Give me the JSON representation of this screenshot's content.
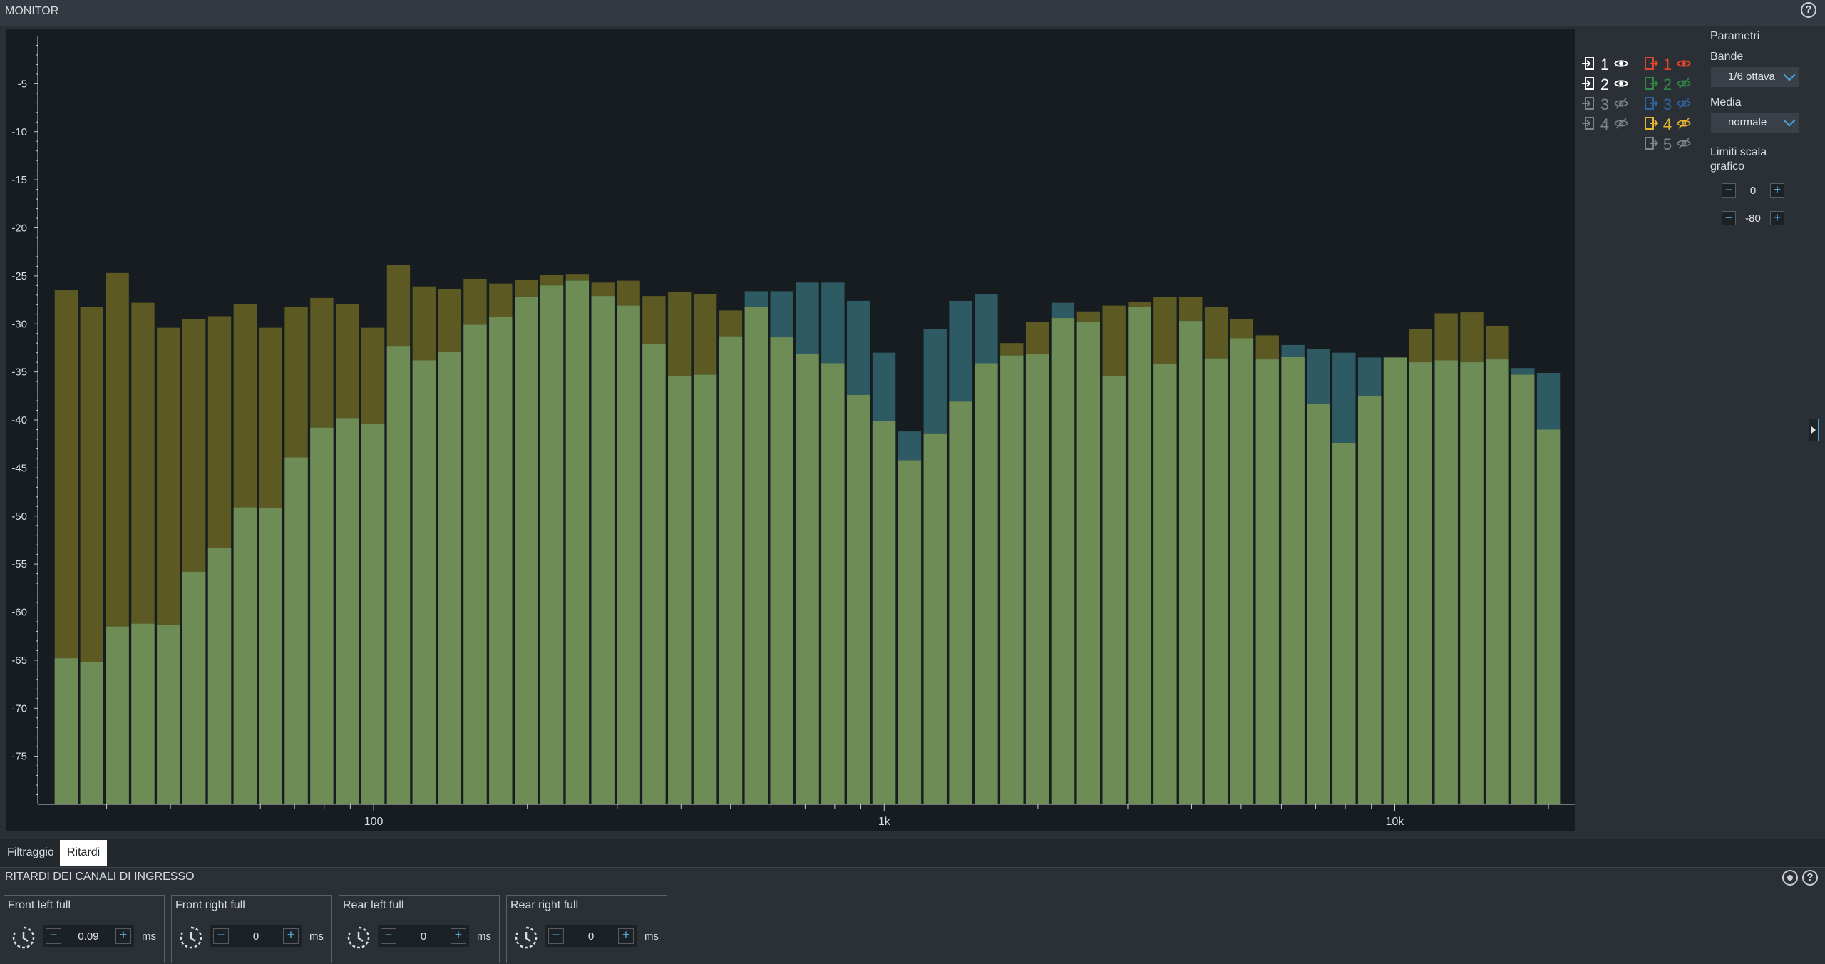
{
  "app": {
    "title": "MONITOR",
    "help_label": "?"
  },
  "colors": {
    "input_bar": "#6e8c55",
    "output_orange_bar": "#5c5a22",
    "output_blue_bar": "#2e5b63",
    "ch_input_active": "#ffffff",
    "ch_output_1": "#e0452d",
    "ch_output_2": "#2ea84a",
    "ch_output_3": "#2f76c4",
    "ch_output_4": "#e6b531",
    "ch_inactive": "#7d848c"
  },
  "channels": {
    "inputs": [
      {
        "num": "1",
        "visible": true,
        "icon": "input-icon",
        "eye": "eye-icon"
      },
      {
        "num": "2",
        "visible": true,
        "icon": "input-icon",
        "eye": "eye-icon"
      },
      {
        "num": "3",
        "visible": false,
        "icon": "input-icon",
        "eye": "eye-off-icon"
      },
      {
        "num": "4",
        "visible": false,
        "icon": "input-icon",
        "eye": "eye-off-icon"
      }
    ],
    "outputs": [
      {
        "num": "1",
        "visible": true,
        "icon": "output-icon",
        "eye": "eye-icon"
      },
      {
        "num": "2",
        "visible": false,
        "icon": "output-icon",
        "eye": "eye-off-icon"
      },
      {
        "num": "3",
        "visible": false,
        "icon": "output-icon",
        "eye": "eye-off-icon"
      },
      {
        "num": "4",
        "visible": false,
        "icon": "output-icon",
        "eye": "eye-off-icon"
      },
      {
        "num": "5",
        "visible": false,
        "icon": "output-icon",
        "eye": "eye-off-icon"
      }
    ]
  },
  "params": {
    "title": "Parametri",
    "bands_label": "Bande",
    "bands_value": "1/6 ottava",
    "media_label": "Media",
    "media_value": "normale",
    "scale_label_1": "Limiti scala",
    "scale_label_2": "grafico",
    "scale_max": "0",
    "scale_min": "-80"
  },
  "tabs": [
    {
      "label": "Filtraggio",
      "active": false
    },
    {
      "label": "Ritardi",
      "active": true
    }
  ],
  "delays": {
    "title": "RITARDI DEI CANALI DI INGRESSO",
    "channels": [
      {
        "name": "Front left full",
        "value": "0.09",
        "unit": "ms"
      },
      {
        "name": "Front right full",
        "value": "0",
        "unit": "ms"
      },
      {
        "name": "Rear left full",
        "value": "0",
        "unit": "ms"
      },
      {
        "name": "Rear right full",
        "value": "0",
        "unit": "ms"
      }
    ]
  },
  "chart_data": {
    "type": "bar",
    "y_ticks": [
      "-5",
      "-10",
      "-15",
      "-20",
      "-25",
      "-30",
      "-35",
      "-40",
      "-45",
      "-50",
      "-55",
      "-60",
      "-65",
      "-70",
      "-75"
    ],
    "x_ticks": [
      "100",
      "1k",
      "10k"
    ],
    "ylim": [
      -80,
      0
    ],
    "x_scale": "log",
    "grid": false,
    "x": [
      25,
      28,
      31.5,
      35.5,
      40,
      45,
      50,
      56,
      63,
      71,
      80,
      90,
      100,
      112,
      125,
      140,
      160,
      180,
      200,
      224,
      250,
      280,
      315,
      355,
      400,
      450,
      500,
      560,
      630,
      710,
      800,
      900,
      1000,
      1120,
      1250,
      1400,
      1600,
      1800,
      2000,
      2240,
      2500,
      2800,
      3150,
      3550,
      4000,
      4500,
      5000,
      5600,
      6300,
      7100,
      8000,
      9000,
      10000,
      11200,
      12500,
      14000,
      16000,
      18000,
      20000
    ],
    "series": [
      {
        "name": "1",
        "color": "#6e8c55",
        "values": [
          -64.8,
          -65.2,
          -61.5,
          -61.2,
          -61.3,
          -55.8,
          -53.3,
          -49.1,
          -49.2,
          -43.9,
          -40.8,
          -39.8,
          -40.4,
          -32.3,
          -33.8,
          -32.9,
          -30.1,
          -29.3,
          -27.2,
          -26.0,
          -25.5,
          -27.1,
          -28.1,
          -32.1,
          -35.4,
          -35.3,
          -31.3,
          -28.2,
          -31.4,
          -33.1,
          -34.1,
          -37.4,
          -40.1,
          -44.2,
          -41.4,
          -38.1,
          -34.1,
          -33.3,
          -33.1,
          -29.4,
          -29.8,
          -35.4,
          -28.2,
          -34.2,
          -29.7,
          -33.6,
          -31.5,
          -33.7,
          -33.4,
          -38.3,
          -42.4,
          -37.5,
          -33.5,
          -34.0,
          -33.8,
          -34.0,
          -33.7,
          -35.3,
          -41.0
        ]
      },
      {
        "name": "1",
        "color": "#5c5a22",
        "values": [
          -26.5,
          -28.2,
          -24.7,
          -27.8,
          -30.4,
          -29.5,
          -29.2,
          -27.9,
          -30.4,
          -28.2,
          -27.3,
          -27.9,
          -30.4,
          -23.9,
          -26.1,
          -26.4,
          -25.3,
          -25.8,
          -25.4,
          -24.9,
          -24.8,
          -25.7,
          -25.5,
          -27.1,
          -26.7,
          -26.9,
          -28.6,
          -28.2,
          -31.4,
          -33.1,
          -34.1,
          -37.4,
          -40.1,
          -44.2,
          -41.4,
          -38.1,
          -34.1,
          -32.0,
          -29.8,
          -29.4,
          -28.7,
          -28.1,
          -27.7,
          -27.2,
          -27.2,
          -28.2,
          -29.5,
          -31.2,
          -33.4,
          -38.3,
          -42.4,
          -37.5,
          -33.5,
          -30.5,
          -28.9,
          -28.8,
          -30.2,
          -35.3,
          -41.0
        ]
      },
      {
        "name": "2",
        "color": "#2e5b63",
        "values": [
          -64.8,
          -65.2,
          -61.5,
          -61.2,
          -61.3,
          -55.8,
          -53.3,
          -49.1,
          -49.2,
          -43.9,
          -40.8,
          -39.8,
          -40.4,
          -32.3,
          -33.8,
          -32.9,
          -30.1,
          -29.3,
          -27.2,
          -26.0,
          -25.5,
          -27.1,
          -28.1,
          -32.1,
          -35.4,
          -35.3,
          -31.3,
          -26.6,
          -26.6,
          -25.7,
          -25.7,
          -27.6,
          -33.0,
          -41.2,
          -30.5,
          -27.6,
          -26.9,
          -33.3,
          -33.1,
          -27.8,
          -29.8,
          -35.4,
          -28.2,
          -34.2,
          -29.7,
          -33.6,
          -31.5,
          -33.7,
          -32.2,
          -32.6,
          -33.0,
          -33.5,
          -33.5,
          -34.0,
          -33.8,
          -34.0,
          -33.7,
          -34.6,
          -35.1
        ]
      }
    ]
  }
}
